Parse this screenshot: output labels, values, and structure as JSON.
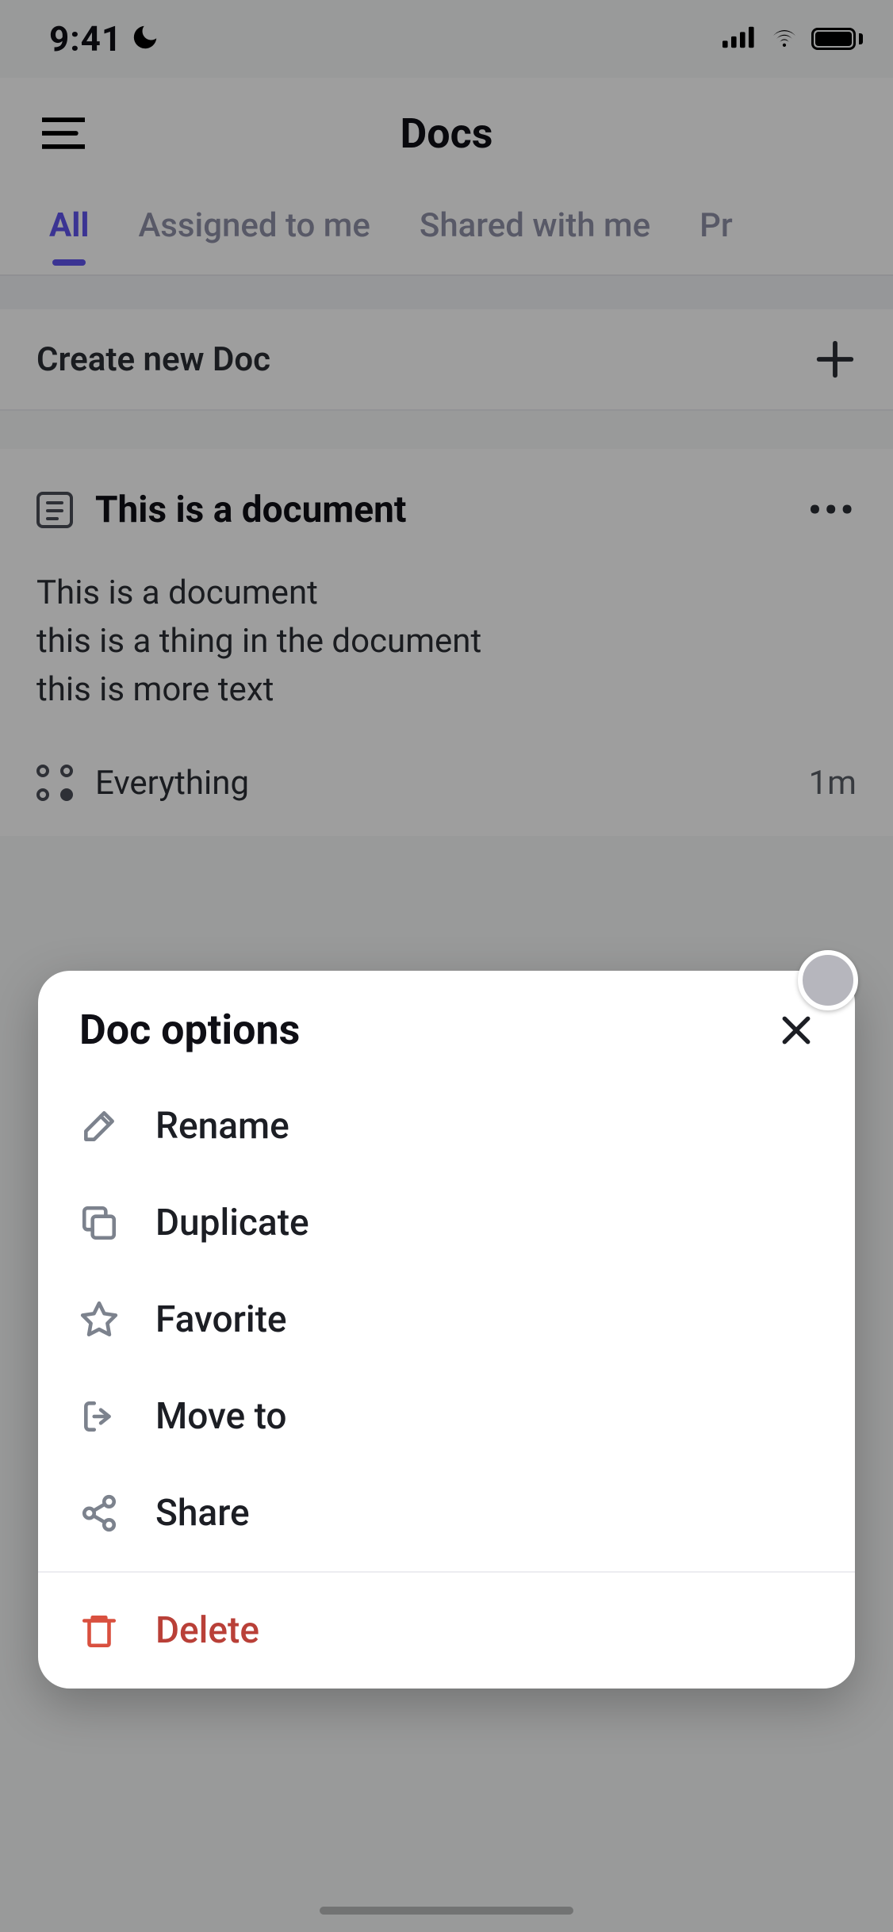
{
  "status": {
    "time": "9:41"
  },
  "header": {
    "title": "Docs"
  },
  "tabs": [
    {
      "label": "All"
    },
    {
      "label": "Assigned to me"
    },
    {
      "label": "Shared with me"
    },
    {
      "label": "Pr"
    }
  ],
  "create_row": {
    "label": "Create new Doc"
  },
  "doc": {
    "title": "This is a document",
    "body": "This is a document\nthis is a thing in the document\nthis is more text",
    "location_label": "Everything",
    "time_label": "1m"
  },
  "sheet": {
    "title": "Doc options",
    "options": [
      {
        "label": "Rename"
      },
      {
        "label": "Duplicate"
      },
      {
        "label": "Favorite"
      },
      {
        "label": "Move to"
      },
      {
        "label": "Share"
      }
    ],
    "delete": {
      "label": "Delete"
    }
  }
}
